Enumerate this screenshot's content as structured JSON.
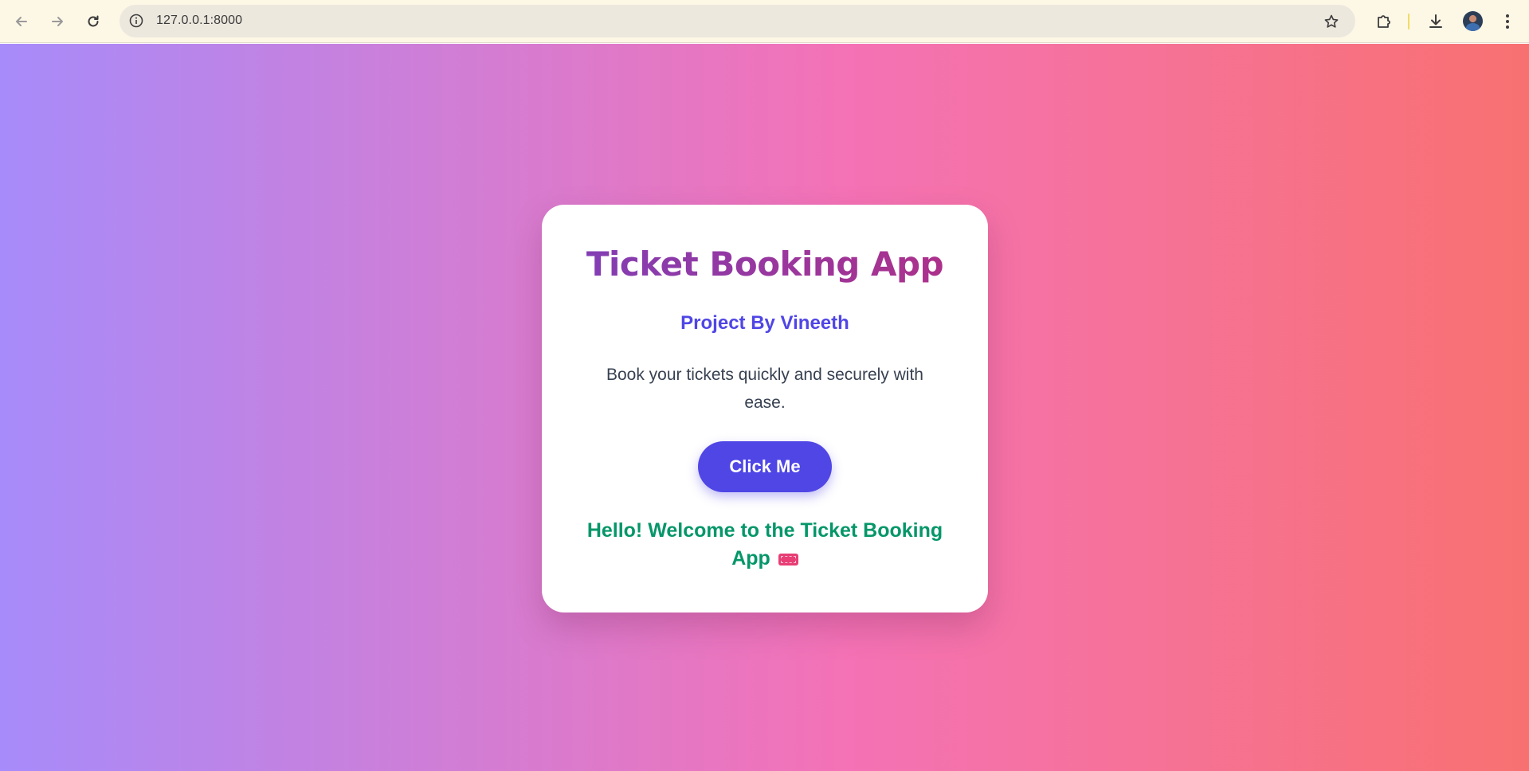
{
  "browser": {
    "url": "127.0.0.1:8000",
    "icons": {
      "back": "back-arrow-icon",
      "forward": "forward-arrow-icon",
      "reload": "reload-icon",
      "site_info": "info-icon",
      "bookmark": "star-icon",
      "extensions": "puzzle-icon",
      "downloads": "download-icon",
      "menu": "kebab-menu-icon"
    }
  },
  "page": {
    "title": "Ticket Booking App",
    "subtitle": "Project By Vineeth",
    "description": "Book your tickets quickly and securely with ease.",
    "button_label": "Click Me",
    "welcome_message": "Hello! Welcome to the Ticket Booking App",
    "welcome_emoji": "ticket-emoji"
  },
  "colors": {
    "gradient_start": "#a78bfa",
    "gradient_mid": "#f472b6",
    "gradient_end": "#f87171",
    "subtitle": "#4f46e5",
    "button": "#4f46e5",
    "welcome": "#059669"
  }
}
